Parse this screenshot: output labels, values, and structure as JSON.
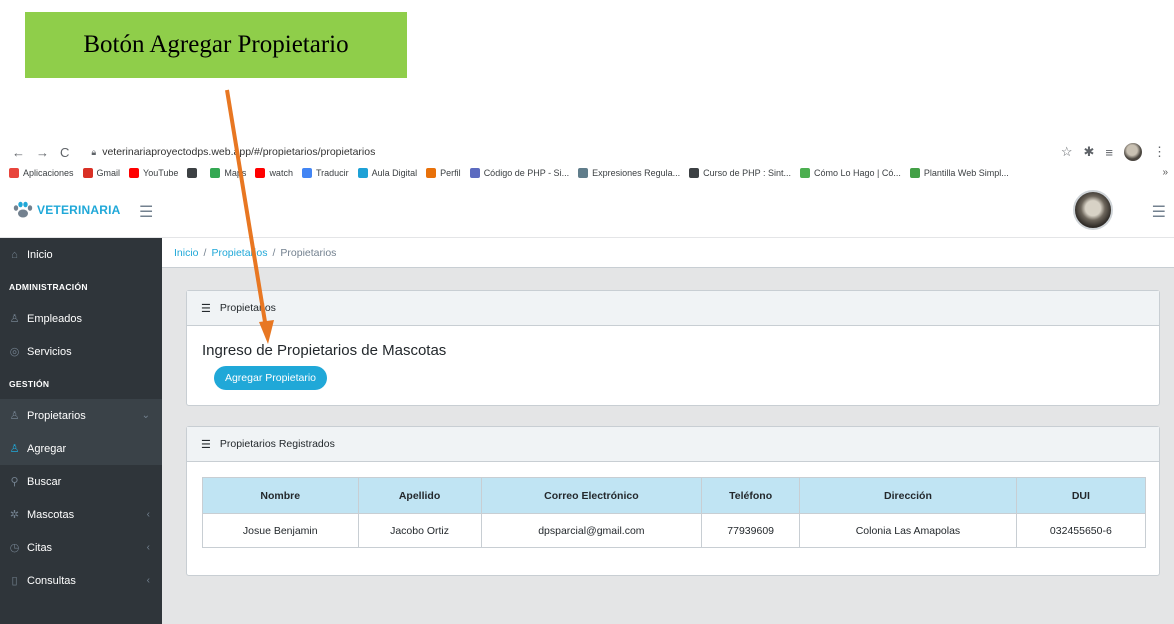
{
  "annotation": {
    "label": "Botón Agregar Propietario"
  },
  "browser": {
    "url": "veterinariaproyectodps.web.app/#/propietarios/propietarios",
    "bookmarks": [
      {
        "label": "Aplicaciones",
        "icon": "apps-grid-icon",
        "color": "#e8453c"
      },
      {
        "label": "Gmail",
        "icon": "gmail-icon",
        "color": "#d93025"
      },
      {
        "label": "YouTube",
        "icon": "youtube-icon",
        "color": "#ff0000"
      },
      {
        "label": "",
        "icon": "globe-icon",
        "color": "#3c4043"
      },
      {
        "label": "Maps",
        "icon": "maps-icon",
        "color": "#34a853"
      },
      {
        "label": "watch",
        "icon": "youtube-icon",
        "color": "#ff0000"
      },
      {
        "label": "Traducir",
        "icon": "translate-icon",
        "color": "#4285f4"
      },
      {
        "label": "Aula Digital",
        "icon": "aula-icon",
        "color": "#1ea1d6"
      },
      {
        "label": "Perfil",
        "icon": "profile-icon",
        "color": "#e8710a"
      },
      {
        "label": "Código de PHP - Si...",
        "icon": "php-icon",
        "color": "#5c6bc0"
      },
      {
        "label": "Expresiones Regula...",
        "icon": "regex-icon",
        "color": "#607d8b"
      },
      {
        "label": "Curso de PHP : Sint...",
        "icon": "globe-icon",
        "color": "#3c4043"
      },
      {
        "label": "Cómo Lo Hago | Có...",
        "icon": "howto-icon",
        "color": "#4caf50"
      },
      {
        "label": "Plantilla Web Simpl...",
        "icon": "code-icon",
        "color": "#43a047"
      }
    ]
  },
  "header": {
    "brand": "VETERINARIA"
  },
  "sidebar": {
    "items": [
      {
        "type": "item",
        "label": "Inicio",
        "icon": "home-icon",
        "glyph": "⌂",
        "name": "sidebar-item-inicio"
      },
      {
        "type": "title",
        "label": "ADMINISTRACIÓN",
        "name": "sidebar-title-administracion"
      },
      {
        "type": "item",
        "label": "Empleados",
        "icon": "user-icon",
        "glyph": "♙",
        "name": "sidebar-item-empleados"
      },
      {
        "type": "item",
        "label": "Servicios",
        "icon": "check-circle-icon",
        "glyph": "◎",
        "name": "sidebar-item-servicios"
      },
      {
        "type": "title",
        "label": "GESTIÓN",
        "name": "sidebar-title-gestion"
      },
      {
        "type": "item",
        "label": "Propietarios",
        "icon": "user-icon",
        "glyph": "♙",
        "chevron": "⌄",
        "name": "sidebar-item-propietarios",
        "state": "open"
      },
      {
        "type": "item",
        "label": "Agregar",
        "icon": "user-icon",
        "glyph": "♙",
        "name": "sidebar-item-agregar",
        "state": "active"
      },
      {
        "type": "item",
        "label": "Buscar",
        "icon": "search-icon",
        "glyph": "⚲",
        "name": "sidebar-item-buscar",
        "state": "sub"
      },
      {
        "type": "item",
        "label": "Mascotas",
        "icon": "pet-icon",
        "glyph": "✲",
        "chevron": "‹",
        "name": "sidebar-item-mascotas"
      },
      {
        "type": "item",
        "label": "Citas",
        "icon": "clock-icon",
        "glyph": "◷",
        "chevron": "‹",
        "name": "sidebar-item-citas"
      },
      {
        "type": "item",
        "label": "Consultas",
        "icon": "document-icon",
        "glyph": "▯",
        "chevron": "‹",
        "name": "sidebar-item-consultas"
      }
    ]
  },
  "breadcrumb": {
    "home": "Inicio",
    "section": "Propietarios",
    "current": "Propietarios"
  },
  "card1": {
    "header": "Propietarios",
    "title": "Ingreso de Propietarios de Mascotas",
    "button": "Agregar Propietario"
  },
  "card2": {
    "header": "Propietarios Registrados",
    "columns": [
      "Nombre",
      "Apellido",
      "Correo Electrónico",
      "Teléfono",
      "Dirección",
      "DUI"
    ],
    "rows": [
      [
        "Josue Benjamin",
        "Jacobo Ortiz",
        "dpsparcial@gmail.com",
        "77939609",
        "Colonia Las Amapolas",
        "032455650-6"
      ]
    ]
  },
  "colors": {
    "accent": "#20a8d8",
    "sidebar": "#2f353a",
    "annotation": "#8fce4a",
    "arrow": "#e87722",
    "table_header": "#c0e4f3"
  }
}
